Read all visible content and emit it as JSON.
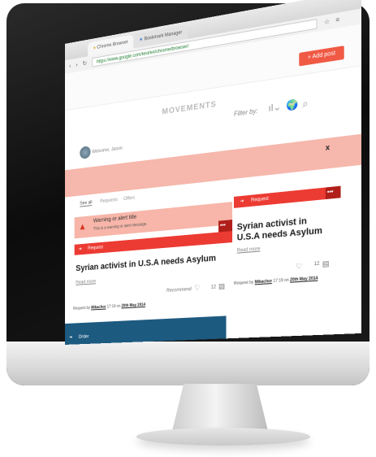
{
  "browser": {
    "tabs": [
      {
        "label": "Chrome Browser"
      },
      {
        "label": "Bookmark Manager"
      }
    ],
    "url": "https://www.google.com/test/en/chrome/browser/"
  },
  "app": {
    "brand": "MOVEMENTS",
    "add_post_label": "+ Add post",
    "filter_label": "Filter by:",
    "welcome_text": "Welcome, Jason",
    "subtabs": [
      {
        "label": "See all"
      },
      {
        "label": "Requests"
      },
      {
        "label": "Offers"
      }
    ],
    "close_label": "x"
  },
  "alert": {
    "title": "Warning or alert title",
    "message": "This is a warning or alert message."
  },
  "cards": [
    {
      "type_label": "Request",
      "headline_line1": "Syrian activist in U.S.A needs Asylum",
      "read_more": "Read more",
      "recommend_label": "Recommend",
      "comment_count": "12",
      "meta_prefix": "Request by",
      "author": "Mikachor",
      "meta_time": "17:19 on",
      "meta_date": "20th May 2014"
    },
    {
      "type_label": "Request",
      "headline_line1": "Syrian activist in",
      "headline_line2": "U.S.A needs Asylum",
      "read_more": "Read more",
      "comment_count": "12",
      "meta_prefix": "Request by",
      "author": "Mikachor",
      "meta_time": "17:19 on",
      "meta_date": "20th May 2014"
    },
    {
      "type_label": "Order"
    }
  ],
  "more_dots": "•••",
  "colors": {
    "request": "#ec3b33",
    "order": "#1d5a80",
    "alert_bg": "#f7b6a9",
    "add_post": "#f05a45"
  }
}
